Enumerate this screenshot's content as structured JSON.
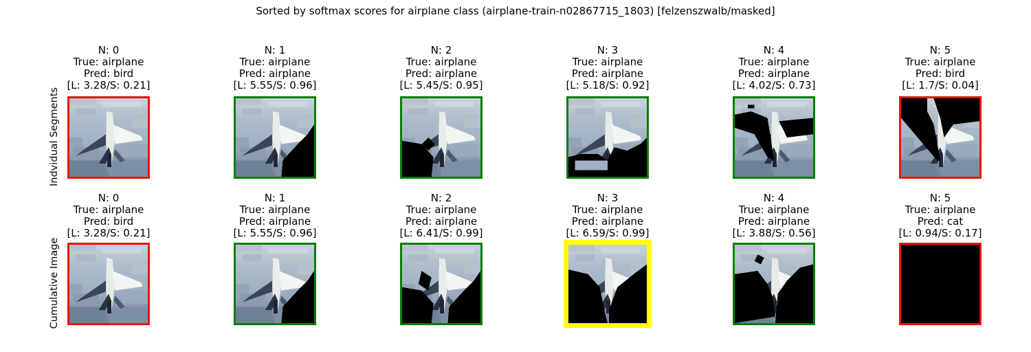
{
  "suptitle": "Sorted by softmax scores for airplane class (airplane-train-n02867715_1803) [felzenszwalb/masked]",
  "row_labels": [
    "Indvidual Segments",
    "Cumulative Image"
  ],
  "colors": {
    "correct": "#0a7d0a",
    "wrong": "#ee1111",
    "best": "#ffff00",
    "mask": "#000000"
  },
  "rows": [
    {
      "name": "individual",
      "cells": [
        {
          "n": "N: 0",
          "true": "True: airplane",
          "pred": "Pred: bird",
          "score": "[L: 3.28/S: 0.21]",
          "status": "wrong",
          "mask": "none"
        },
        {
          "n": "N: 1",
          "true": "True: airplane",
          "pred": "Pred: airplane",
          "score": "[L: 5.55/S: 0.96]",
          "status": "correct",
          "mask": "bottom-right"
        },
        {
          "n": "N: 2",
          "true": "True: airplane",
          "pred": "Pred: airplane",
          "score": "[L: 5.45/S: 0.95]",
          "status": "correct",
          "mask": "bottom-left"
        },
        {
          "n": "N: 3",
          "true": "True: airplane",
          "pred": "Pred: airplane",
          "score": "[L: 5.18/S: 0.92]",
          "status": "correct",
          "mask": "bottom-center"
        },
        {
          "n": "N: 4",
          "true": "True: airplane",
          "pred": "Pred: airplane",
          "score": "[L: 4.02/S: 0.73]",
          "status": "correct",
          "mask": "top-left-band"
        },
        {
          "n": "N: 5",
          "true": "True: airplane",
          "pred": "Pred: bird",
          "score": "[L: 1.7/S: 0.04]",
          "status": "wrong",
          "mask": "top-v"
        }
      ]
    },
    {
      "name": "cumulative",
      "cells": [
        {
          "n": "N: 0",
          "true": "True: airplane",
          "pred": "Pred: bird",
          "score": "[L: 3.28/S: 0.21]",
          "status": "wrong",
          "mask": "none"
        },
        {
          "n": "N: 1",
          "true": "True: airplane",
          "pred": "Pred: airplane",
          "score": "[L: 5.55/S: 0.96]",
          "status": "correct",
          "mask": "bottom-right"
        },
        {
          "n": "N: 2",
          "true": "True: airplane",
          "pred": "Pred: airplane",
          "score": "[L: 6.41/S: 0.99]",
          "status": "correct",
          "mask": "bottom-both"
        },
        {
          "n": "N: 3",
          "true": "True: airplane",
          "pred": "Pred: airplane",
          "score": "[L: 6.59/S: 0.99]",
          "status": "best",
          "mask": "bottom-v"
        },
        {
          "n": "N: 4",
          "true": "True: airplane",
          "pred": "Pred: airplane",
          "score": "[L: 3.88/S: 0.56]",
          "status": "correct",
          "mask": "mostly"
        },
        {
          "n": "N: 5",
          "true": "True: airplane",
          "pred": "Pred: cat",
          "score": "[L: 0.94/S: 0.17]",
          "status": "wrong",
          "mask": "all"
        }
      ]
    }
  ]
}
